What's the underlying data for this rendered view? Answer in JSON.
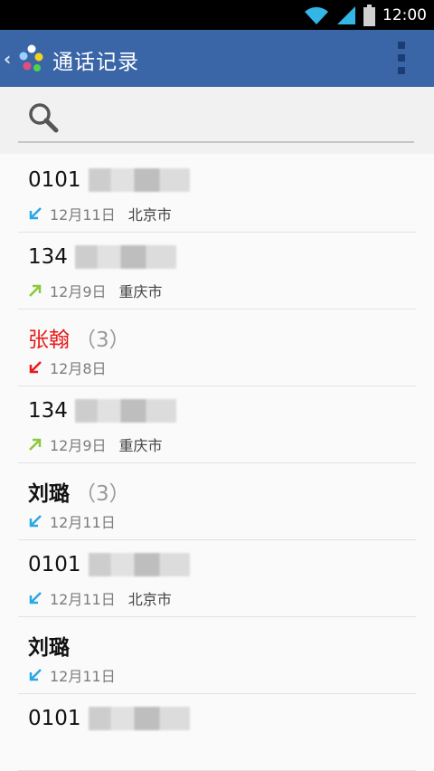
{
  "status_bar": {
    "time": "12:00"
  },
  "action_bar": {
    "back": "‹",
    "title": "通话记录"
  },
  "search": {
    "placeholder": ""
  },
  "calls": [
    {
      "name": "0101",
      "count": "",
      "type": "incoming",
      "date": "12月11日",
      "location": "北京市"
    },
    {
      "name": "134",
      "count": "",
      "type": "outgoing",
      "date": "12月9日",
      "location": "重庆市"
    },
    {
      "name": "张翰",
      "count": "（3）",
      "type": "missed",
      "date": "12月8日",
      "location": ""
    },
    {
      "name": "134",
      "count": "",
      "type": "outgoing",
      "date": "12月9日",
      "location": "重庆市"
    },
    {
      "name": "刘璐",
      "count": "（3）",
      "type": "incoming",
      "date": "12月11日",
      "location": ""
    },
    {
      "name": "0101",
      "count": "",
      "type": "incoming",
      "date": "12月11日",
      "location": "北京市"
    },
    {
      "name": "刘璐",
      "count": "",
      "type": "incoming",
      "date": "12月11日",
      "location": ""
    },
    {
      "name": "0101",
      "count": "",
      "type": "incoming",
      "date": "",
      "location": ""
    }
  ],
  "colors": {
    "action_bar": "#3a66a8",
    "incoming_arrow": "#2aa7e4",
    "outgoing_arrow": "#8ac83c",
    "missed_arrow": "#e81b1b",
    "missed_text": "#e81b1b"
  },
  "icons": {
    "incoming": "arrow-down-left-icon",
    "outgoing": "arrow-up-right-icon",
    "missed": "arrow-down-left-icon"
  }
}
